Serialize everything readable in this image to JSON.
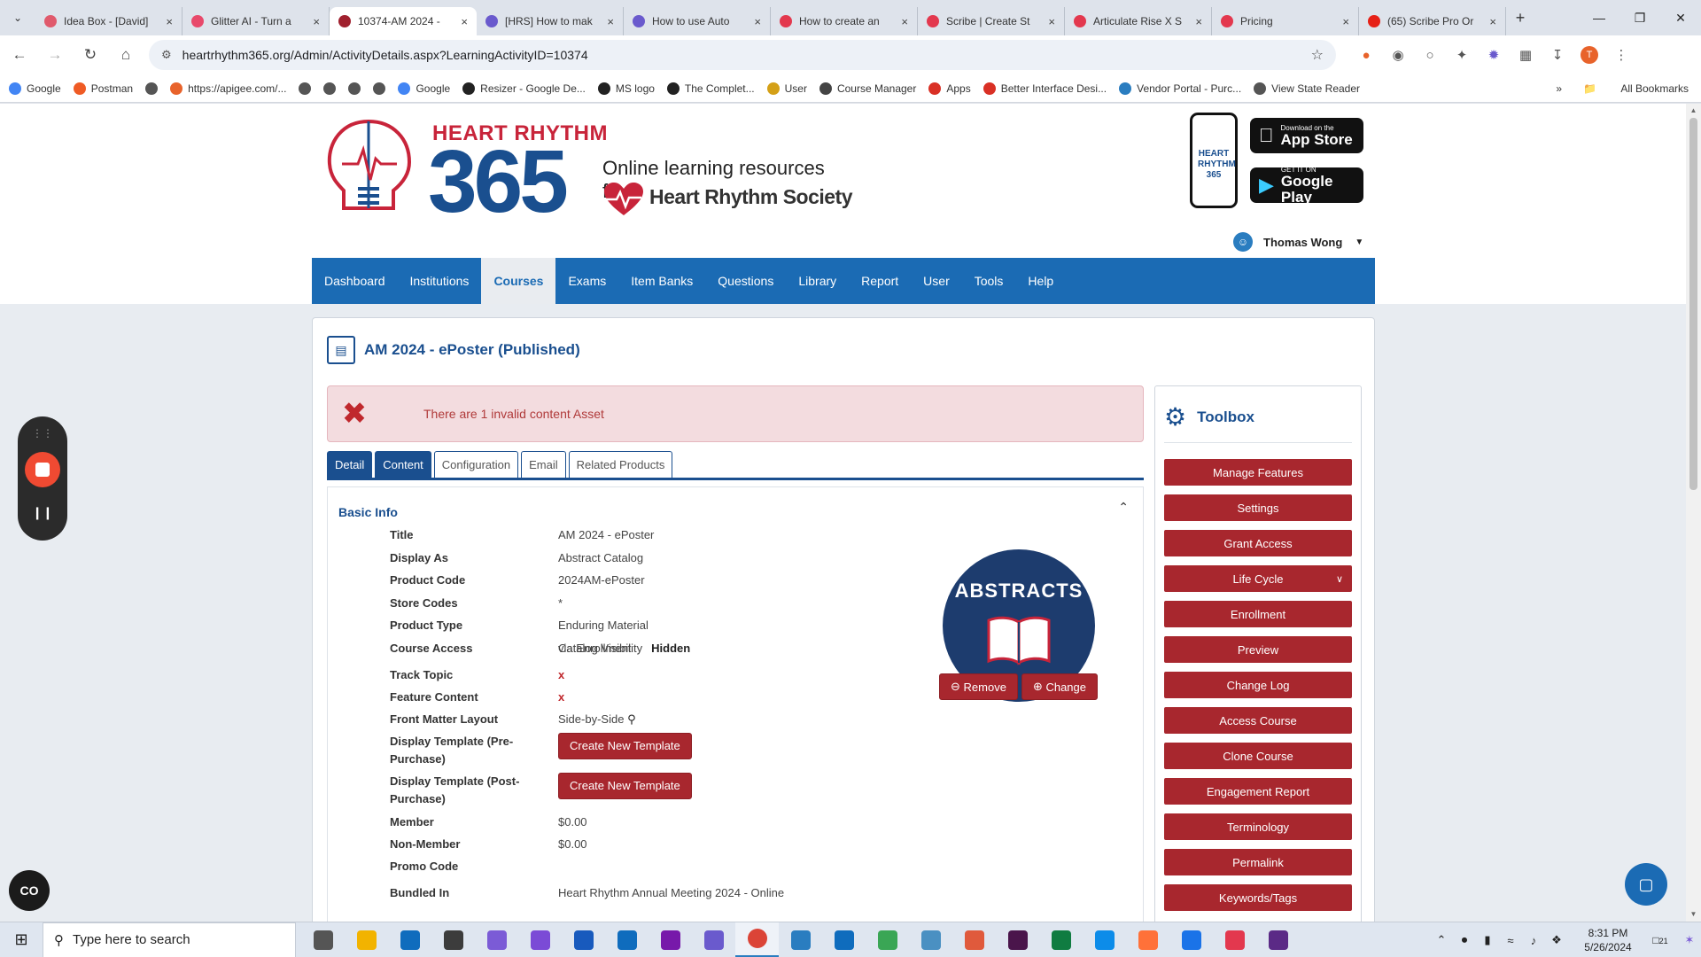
{
  "browser": {
    "tabs": [
      {
        "title": "Idea Box - [David]",
        "color": "#e05a6c",
        "active": false
      },
      {
        "title": "Glitter AI - Turn a",
        "color": "#e8496b",
        "active": false
      },
      {
        "title": "10374-AM 2024 -",
        "color": "#a0202e",
        "active": true
      },
      {
        "title": "[HRS] How to mak",
        "color": "#6a5acd",
        "active": false
      },
      {
        "title": "How to use Auto",
        "color": "#6a5acd",
        "active": false
      },
      {
        "title": "How to create an",
        "color": "#e3384e",
        "active": false
      },
      {
        "title": "Scribe | Create St",
        "color": "#e3384e",
        "active": false
      },
      {
        "title": "Articulate Rise X S",
        "color": "#e3384e",
        "active": false
      },
      {
        "title": "Pricing",
        "color": "#e3384e",
        "active": false
      },
      {
        "title": "(65) Scribe Pro Or",
        "color": "#e62117",
        "active": false
      }
    ],
    "url": "heartrhythm365.org/Admin/ActivityDetails.aspx?LearningActivityID=10374",
    "profile_initial": "T",
    "bookmarks": [
      {
        "label": "Google",
        "color": "#4285f4"
      },
      {
        "label": "Postman",
        "color": "#ef5b25"
      },
      {
        "label": "",
        "color": "#555555"
      },
      {
        "label": "https://apigee.com/...",
        "color": "#e8632b"
      },
      {
        "label": "",
        "color": "#555555"
      },
      {
        "label": "",
        "color": "#555555"
      },
      {
        "label": "",
        "color": "#555555"
      },
      {
        "label": "",
        "color": "#555555"
      },
      {
        "label": "Google",
        "color": "#4285f4"
      },
      {
        "label": "Resizer - Google De...",
        "color": "#222222"
      },
      {
        "label": "MS logo",
        "color": "#222222"
      },
      {
        "label": "The Complet...",
        "color": "#222222"
      },
      {
        "label": "User",
        "color": "#d4a017"
      },
      {
        "label": "Course Manager",
        "color": "#444444"
      },
      {
        "label": "Apps",
        "color": "#d93025"
      },
      {
        "label": "Better Interface Desi...",
        "color": "#d93025"
      },
      {
        "label": "Vendor Portal - Purc...",
        "color": "#2a7dc0"
      },
      {
        "label": "View State Reader",
        "color": "#555555"
      }
    ],
    "all_bookmarks": "All Bookmarks"
  },
  "header": {
    "brand_top": "HEART RHYTHM",
    "brand_num": "365",
    "tagline": "Online learning resources from",
    "society": "Heart Rhythm Society",
    "phone_label": "HEART RHYTHM 365",
    "app_store": {
      "small": "Download on the",
      "big": "App Store"
    },
    "google_play": {
      "small": "GET IT ON",
      "big": "Google Play"
    },
    "user_name": "Thomas Wong"
  },
  "nav": {
    "items": [
      "Dashboard",
      "Institutions",
      "Courses",
      "Exams",
      "Item Banks",
      "Questions",
      "Library",
      "Report",
      "User",
      "Tools",
      "Help"
    ],
    "active": "Courses"
  },
  "activity": {
    "title": "AM 2024 - ePoster (Published)",
    "alert": "There are 1 invalid content Asset",
    "tabs": [
      "Detail",
      "Content",
      "Configuration",
      "Email",
      "Related Products"
    ],
    "section": "Basic Info",
    "fields": [
      {
        "label": "Title",
        "value": "AM 2024 - ePoster"
      },
      {
        "label": "Display As",
        "value": "Abstract Catalog"
      },
      {
        "label": "Product Code",
        "value": "2024AM-ePoster"
      },
      {
        "label": "Store Codes",
        "value": "*"
      },
      {
        "label": "Product Type",
        "value": "Enduring Material"
      },
      {
        "label": "Course Access",
        "value": "via Enrollment"
      }
    ],
    "catalog_visibility_label": "Catalog Visibility",
    "catalog_visibility_value": "Hidden",
    "track_topic_label": "Track Topic",
    "track_topic_value": "x",
    "feature_content_label": "Feature Content",
    "feature_content_value": "x",
    "front_matter_label": "Front Matter Layout",
    "front_matter_value": "Side-by-Side",
    "display_pre_label_1": "Display Template (Pre-",
    "display_pre_label_2": "Purchase)",
    "display_post_label_1": "Display Template (Post-",
    "display_post_label_2": "Purchase)",
    "create_template": "Create New Template",
    "member_label": "Member",
    "member_value": "$0.00",
    "nonmember_label": "Non-Member",
    "nonmember_value": "$0.00",
    "promo_label": "Promo Code",
    "bundled_label": "Bundled In",
    "bundled_value": "Heart Rhythm Annual Meeting 2024 - Online",
    "badge_text": "ABSTRACTS",
    "remove": "Remove",
    "change": "Change"
  },
  "toolbox": {
    "title": "Toolbox",
    "buttons": [
      "Manage Features",
      "Settings",
      "Grant Access",
      "Life Cycle",
      "Enrollment",
      "Preview",
      "Change Log",
      "Access Course",
      "Clone Course",
      "Engagement Report",
      "Terminology",
      "Permalink",
      "Keywords/Tags"
    ]
  },
  "taskbar": {
    "search_placeholder": "Type here to search",
    "time": "8:31 PM",
    "date": "5/26/2024",
    "notif_count": "21",
    "apps": [
      {
        "name": "task-view",
        "color": "#555555"
      },
      {
        "name": "file-explorer",
        "color": "#f2b300"
      },
      {
        "name": "mail",
        "color": "#0f6cbd"
      },
      {
        "name": "app-a",
        "color": "#3c3c3c"
      },
      {
        "name": "app-b",
        "color": "#7b5bd6"
      },
      {
        "name": "visual-studio",
        "color": "#7b4bd6"
      },
      {
        "name": "word",
        "color": "#185abd"
      },
      {
        "name": "outlook",
        "color": "#0f6cbd"
      },
      {
        "name": "onenote",
        "color": "#7719aa"
      },
      {
        "name": "app-c",
        "color": "#6a5acd"
      },
      {
        "name": "chrome",
        "color": "#db4437"
      },
      {
        "name": "app-d",
        "color": "#2a7dc0"
      },
      {
        "name": "app-e",
        "color": "#0f6cbd"
      },
      {
        "name": "app-f",
        "color": "#3aa655"
      },
      {
        "name": "app-g",
        "color": "#4a90c2"
      },
      {
        "name": "app-h",
        "color": "#e05a3c"
      },
      {
        "name": "slack",
        "color": "#4a154b"
      },
      {
        "name": "excel",
        "color": "#107c41"
      },
      {
        "name": "edge",
        "color": "#0c8ce9"
      },
      {
        "name": "firefox",
        "color": "#ff7139"
      },
      {
        "name": "maps",
        "color": "#1a73e8"
      },
      {
        "name": "scribe",
        "color": "#e3384e"
      },
      {
        "name": "app-i",
        "color": "#5b2a86"
      }
    ]
  }
}
